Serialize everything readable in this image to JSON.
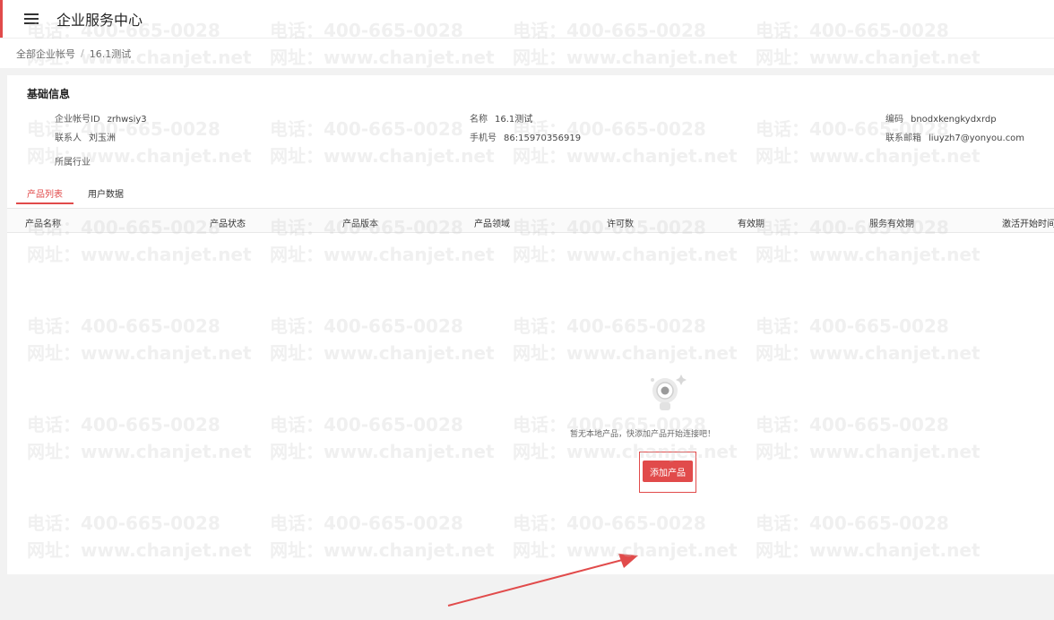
{
  "header": {
    "title": "企业服务中心"
  },
  "breadcrumb": {
    "root": "全部企业帐号",
    "separator": "/",
    "current": "16.1测试"
  },
  "basic_info": {
    "title": "基础信息",
    "fields": [
      {
        "label": "企业帐号ID",
        "value": "zrhwsiy3"
      },
      {
        "label": "名称",
        "value": "16.1测试"
      },
      {
        "label": "编码",
        "value": "bnodxkengkydxrdp"
      },
      {
        "label": "联系人",
        "value": "刘玉洲"
      },
      {
        "label": "手机号",
        "value": "86:15970356919"
      },
      {
        "label": "联系邮箱",
        "value": "liuyzh7@yonyou.com"
      },
      {
        "label": "所属行业",
        "value": ""
      }
    ]
  },
  "tabs": [
    {
      "label": "产品列表",
      "active": true
    },
    {
      "label": "用户数据",
      "active": false
    }
  ],
  "table": {
    "columns": [
      "产品名称",
      "产品状态",
      "产品版本",
      "产品领域",
      "许可数",
      "有效期",
      "服务有效期",
      "激活开始时间"
    ]
  },
  "empty_state": {
    "icon": "robot-empty-icon",
    "text": "暂无本地产品，快添加产品开始连接吧！",
    "button_label": "添加产品"
  },
  "watermark": {
    "phone": "电话：400-665-0028",
    "site": "网址：www.chanjet.net"
  },
  "colors": {
    "accent": "#e14b4b"
  }
}
